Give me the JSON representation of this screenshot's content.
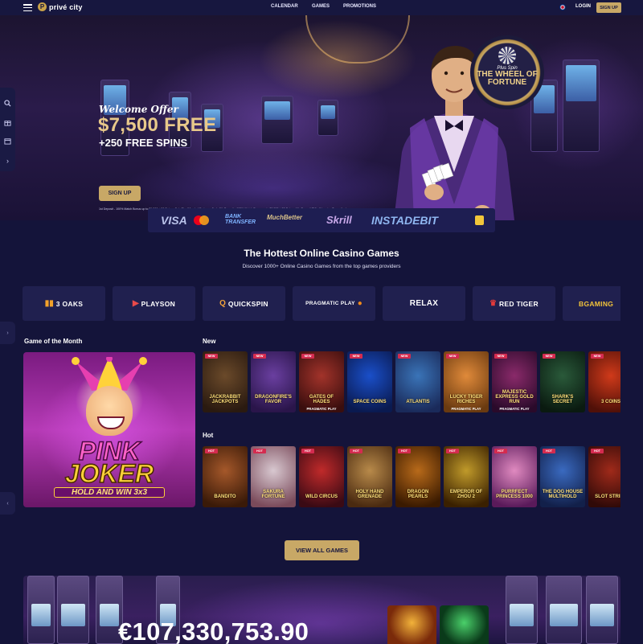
{
  "nav": {
    "brand": "privé city",
    "brand_initial": "P",
    "links": [
      "CALENDAR",
      "GAMES",
      "PROMOTIONS"
    ],
    "login": "LOGIN",
    "signup": "SIGN UP"
  },
  "hero": {
    "welcome": "Welcome Offer",
    "amount": "$7,500 FREE",
    "spins": "+250 FREE SPINS",
    "cta": "SIGN UP",
    "terms": "1st Deposit - 100% Match Bonus up to $1,500 + 50 Spins • Spin The Wheel of Fortune • 2nd - 5th Deposit - 100% Match Bonus up to $1,500 + 50 Spins • Min Deposit $10 • Wagering Terms Apply",
    "wheel_small": "Plus Spin",
    "wheel_title": "THE WHEEL OF FORTUNE"
  },
  "payments": {
    "visa": "VISA",
    "bank": "BANK TRANSFER",
    "muchbetter": "MuchBetter",
    "skrill": "Skrill",
    "instadebit": "INSTADEBIT"
  },
  "section": {
    "title": "The Hottest Online Casino Games",
    "subtitle": "Discover 1000+ Online Casino Games from the top games providers"
  },
  "providers": [
    "3 OAKS",
    "PLAYSON",
    "QUICKSPIN",
    "PRAGMATIC PLAY",
    "RELAX",
    "RED TIGER",
    "BGAMING"
  ],
  "gotm": {
    "heading": "Game of the Month",
    "line1": "PINK",
    "line2": "JOKER",
    "line3": "HOLD AND WIN 3x3"
  },
  "rows": {
    "new_heading": "New",
    "hot_heading": "Hot",
    "badge": "NEW",
    "hot_badge": "HOT",
    "new_games": [
      {
        "title": "JACKRABBIT JACKPOTS",
        "caption": "",
        "colors": [
          "#6b4a2a",
          "#2a1a10"
        ]
      },
      {
        "title": "DRAGONFIRE'S FAVOR",
        "caption": "",
        "colors": [
          "#6a3fa0",
          "#2a154a"
        ]
      },
      {
        "title": "GATES OF HADES",
        "caption": "PRAGMATIC PLAY",
        "colors": [
          "#a2332a",
          "#3a0e0e"
        ]
      },
      {
        "title": "SPACE COINS",
        "caption": "",
        "colors": [
          "#1a4fc9",
          "#0a1a50"
        ]
      },
      {
        "title": "ATLANTIS",
        "caption": "",
        "colors": [
          "#3a74b8",
          "#1a2a5a"
        ]
      },
      {
        "title": "LUCKY TIGER RICHES",
        "caption": "PRAGMATIC PLAY",
        "colors": [
          "#e08a3a",
          "#6a3a10"
        ]
      },
      {
        "title": "MAJESTIC EXPRESS GOLD RUN",
        "caption": "PRAGMATIC PLAY",
        "colors": [
          "#8a2a6a",
          "#2a0a2a"
        ]
      },
      {
        "title": "SHARK'S SECRET",
        "caption": "",
        "colors": [
          "#2a5a3a",
          "#0a1a10"
        ]
      },
      {
        "title": "3 COINS",
        "caption": "",
        "colors": [
          "#d03a1a",
          "#501008"
        ]
      }
    ],
    "hot_games": [
      {
        "title": "BANDITO",
        "caption": "",
        "colors": [
          "#a5582a",
          "#3a1a08"
        ]
      },
      {
        "title": "SAKURA FORTUNE",
        "caption": "",
        "colors": [
          "#d8c8d0",
          "#7a4a5a"
        ]
      },
      {
        "title": "WILD CIRCUS",
        "caption": "",
        "colors": [
          "#c02a2a",
          "#3a0a14"
        ]
      },
      {
        "title": "HOLY HAND GRENADE",
        "caption": "",
        "colors": [
          "#b88a4a",
          "#4a2a10"
        ]
      },
      {
        "title": "DRAGON PEARLS",
        "caption": "",
        "colors": [
          "#b86a1a",
          "#3a1a00"
        ]
      },
      {
        "title": "EMPEROR OF ZHOU 2",
        "caption": "",
        "colors": [
          "#c09a2a",
          "#3a2000"
        ]
      },
      {
        "title": "PURRFECT PRINCESS 1000",
        "caption": "",
        "colors": [
          "#e08ac0",
          "#5a1a5a"
        ]
      },
      {
        "title": "THE DOG HOUSE MULTIHOLD",
        "caption": "",
        "colors": [
          "#3a6ac0",
          "#12204a"
        ]
      },
      {
        "title": "SLOT STRIKE",
        "caption": "",
        "colors": [
          "#a02a1a",
          "#300a08"
        ]
      }
    ]
  },
  "view_all": "VIEW ALL GAMES",
  "jackpot": {
    "amount": "€107,330,753.90"
  },
  "colors": {
    "background": "#14143a",
    "nav": "#17173f",
    "gold": "#c8a866",
    "card": "#20204f"
  }
}
